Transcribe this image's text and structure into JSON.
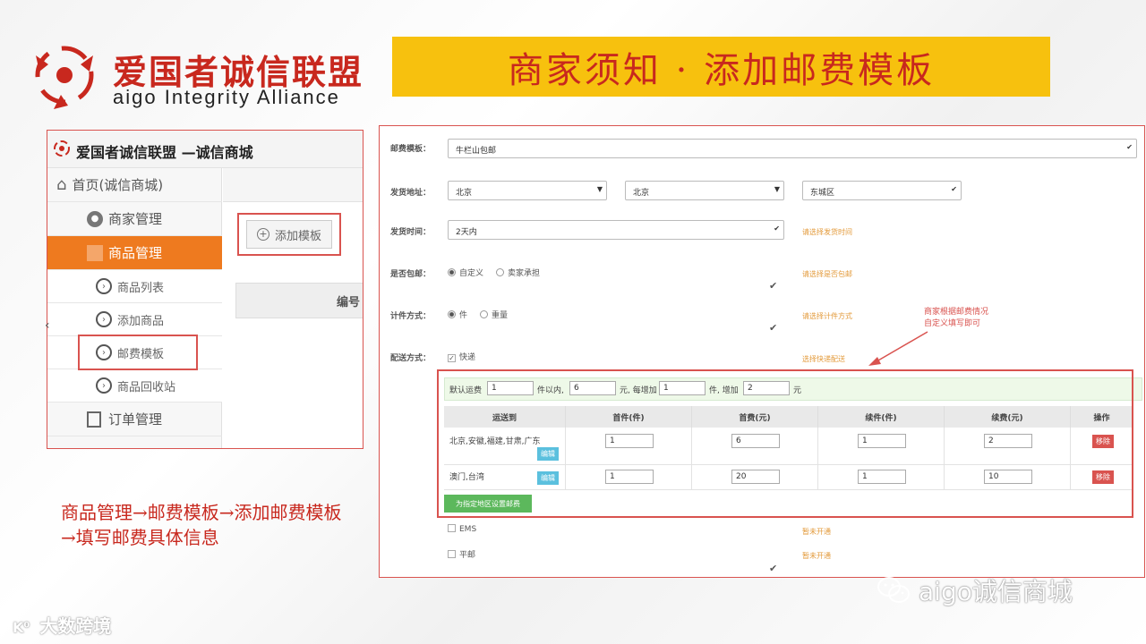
{
  "logo": {
    "cn": "爱国者诚信联盟",
    "en": "aigo  Integrity  Alliance"
  },
  "banner": {
    "title": "商家须知 · 添加邮费模板"
  },
  "admin": {
    "header_title": "爱国者诚信联盟 —诚信商城",
    "sidebar": {
      "home": "首页(诚信商城)",
      "merchant": "商家管理",
      "goods": "商品管理",
      "goods_list": "商品列表",
      "add_goods": "添加商品",
      "postage_tpl": "邮费模板",
      "recycle": "商品回收站",
      "orders": "订单管理"
    },
    "add_template_btn": "添加模板",
    "col_number": "编号"
  },
  "form": {
    "template_label": "邮费模板：",
    "template_value": "牛栏山包邮",
    "address_label": "发货地址：",
    "province": "北京",
    "city": "北京",
    "district": "东城区",
    "time_label": "发货时间：",
    "time_value": "2天内",
    "time_hint": "请选择发货时间",
    "free_label": "是否包邮：",
    "free_opt1": "自定义",
    "free_opt2": "卖家承担",
    "free_hint": "请选择是否包邮",
    "calc_label": "计件方式：",
    "calc_opt1": "件",
    "calc_opt2": "重量",
    "calc_hint": "请选择计件方式",
    "ship_label": "配送方式：",
    "express": "快递",
    "ship_hint": "选择快递配送",
    "default_text": "默认运费",
    "default_first": "1",
    "default_unit1": "件以内,",
    "default_fee": "6",
    "default_unit2": "元, 每增加",
    "default_more": "1",
    "default_unit3": "件, 增加",
    "default_add": "2",
    "default_unit4": "元",
    "table": {
      "headers": [
        "运送到",
        "首件(件)",
        "首费(元)",
        "续件(件)",
        "续费(元)",
        "操作"
      ],
      "rows": [
        {
          "dest": "北京,安徽,福建,甘肃,广东",
          "first": "1",
          "fee": "6",
          "more": "1",
          "add": "2"
        },
        {
          "dest": "澳门,台湾",
          "first": "1",
          "fee": "20",
          "more": "1",
          "add": "10"
        }
      ],
      "edit": "编辑",
      "del": "移除"
    },
    "set_region_btn": "为指定地区设置邮费",
    "ems": "EMS",
    "ems_hint": "暂未开通",
    "post": "平邮",
    "post_hint": "暂未开通",
    "callout": [
      "商家根据邮费情况",
      "自定义填写即可"
    ]
  },
  "footer": {
    "path": "商品管理→邮费模板→添加邮费模板→填写邮费具体信息",
    "wm_left": "大数跨境",
    "wm_right": "aigo诚信商城"
  },
  "colors": {
    "brand_red": "#c8281e",
    "banner_yellow": "#f7c10e",
    "active_orange": "#ee7a1f"
  }
}
